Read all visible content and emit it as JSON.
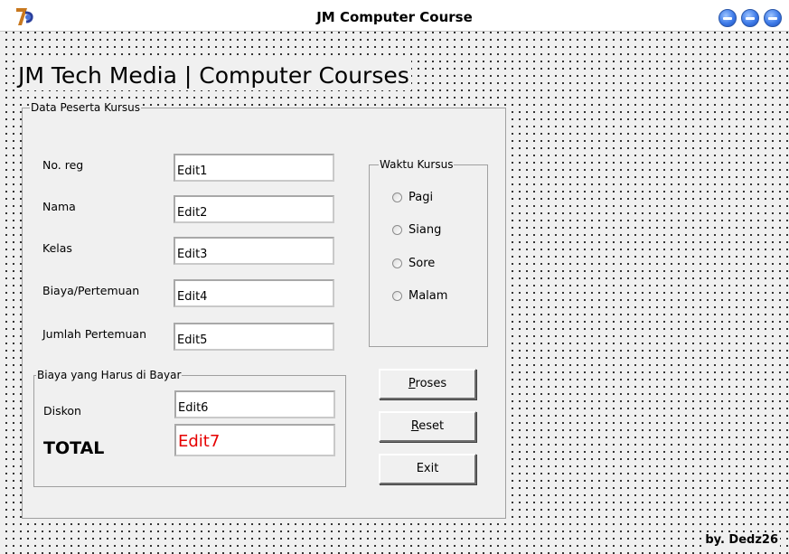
{
  "window": {
    "title": "JM Computer Course",
    "buttons": [
      "minimize",
      "maximize",
      "close"
    ],
    "accent": "#3d7ae8"
  },
  "form": {
    "heading": "JM Tech Media | Computer  Courses",
    "group_data": {
      "caption": "Data Peserta Kursus",
      "fields": [
        {
          "label": "No. reg",
          "value": "Edit1"
        },
        {
          "label": "Nama",
          "value": "Edit2"
        },
        {
          "label": "Kelas",
          "value": "Edit3"
        },
        {
          "label": "Biaya/Pertemuan",
          "value": "Edit4"
        },
        {
          "label": "Jumlah Pertemuan",
          "value": "Edit5"
        }
      ]
    },
    "group_waktu": {
      "caption": "Waktu Kursus",
      "options": [
        "Pagi",
        "Siang",
        "Sore",
        "Malam"
      ]
    },
    "group_biaya": {
      "caption": "Biaya yang Harus di Bayar",
      "diskon_label": "Diskon",
      "diskon_value": "Edit6",
      "total_label": "TOTAL",
      "total_value": "Edit7",
      "total_color": "#e60000"
    },
    "buttons": {
      "proses": {
        "mnemonic": "P",
        "rest": "roses"
      },
      "reset": {
        "mnemonic": "R",
        "rest": "eset"
      },
      "exit": "Exit"
    },
    "credit": "by. Dedz26"
  }
}
